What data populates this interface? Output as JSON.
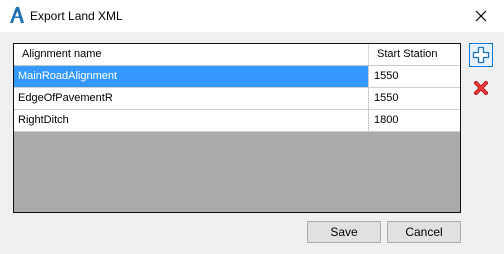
{
  "window": {
    "title": "Export Land XML",
    "app_icon": "autocad-a-icon",
    "close_icon": "close-icon"
  },
  "grid": {
    "columns": [
      "Alignment name",
      "Start Station"
    ],
    "rows": [
      {
        "name": "MainRoadAlignment",
        "station": "1550",
        "selected": true
      },
      {
        "name": "EdgeOfPavementR",
        "station": "1550",
        "selected": false
      },
      {
        "name": "RightDitch",
        "station": "1800",
        "selected": false
      }
    ]
  },
  "toolbar": {
    "add_icon": "add-plus-icon",
    "delete_icon": "delete-x-icon"
  },
  "buttons": {
    "save_label": "Save",
    "cancel_label": "Cancel"
  },
  "colors": {
    "selection": "#3399ff",
    "grid_background": "#ababab",
    "add_icon": "#1e73be",
    "delete_icon": "#e0282d"
  }
}
